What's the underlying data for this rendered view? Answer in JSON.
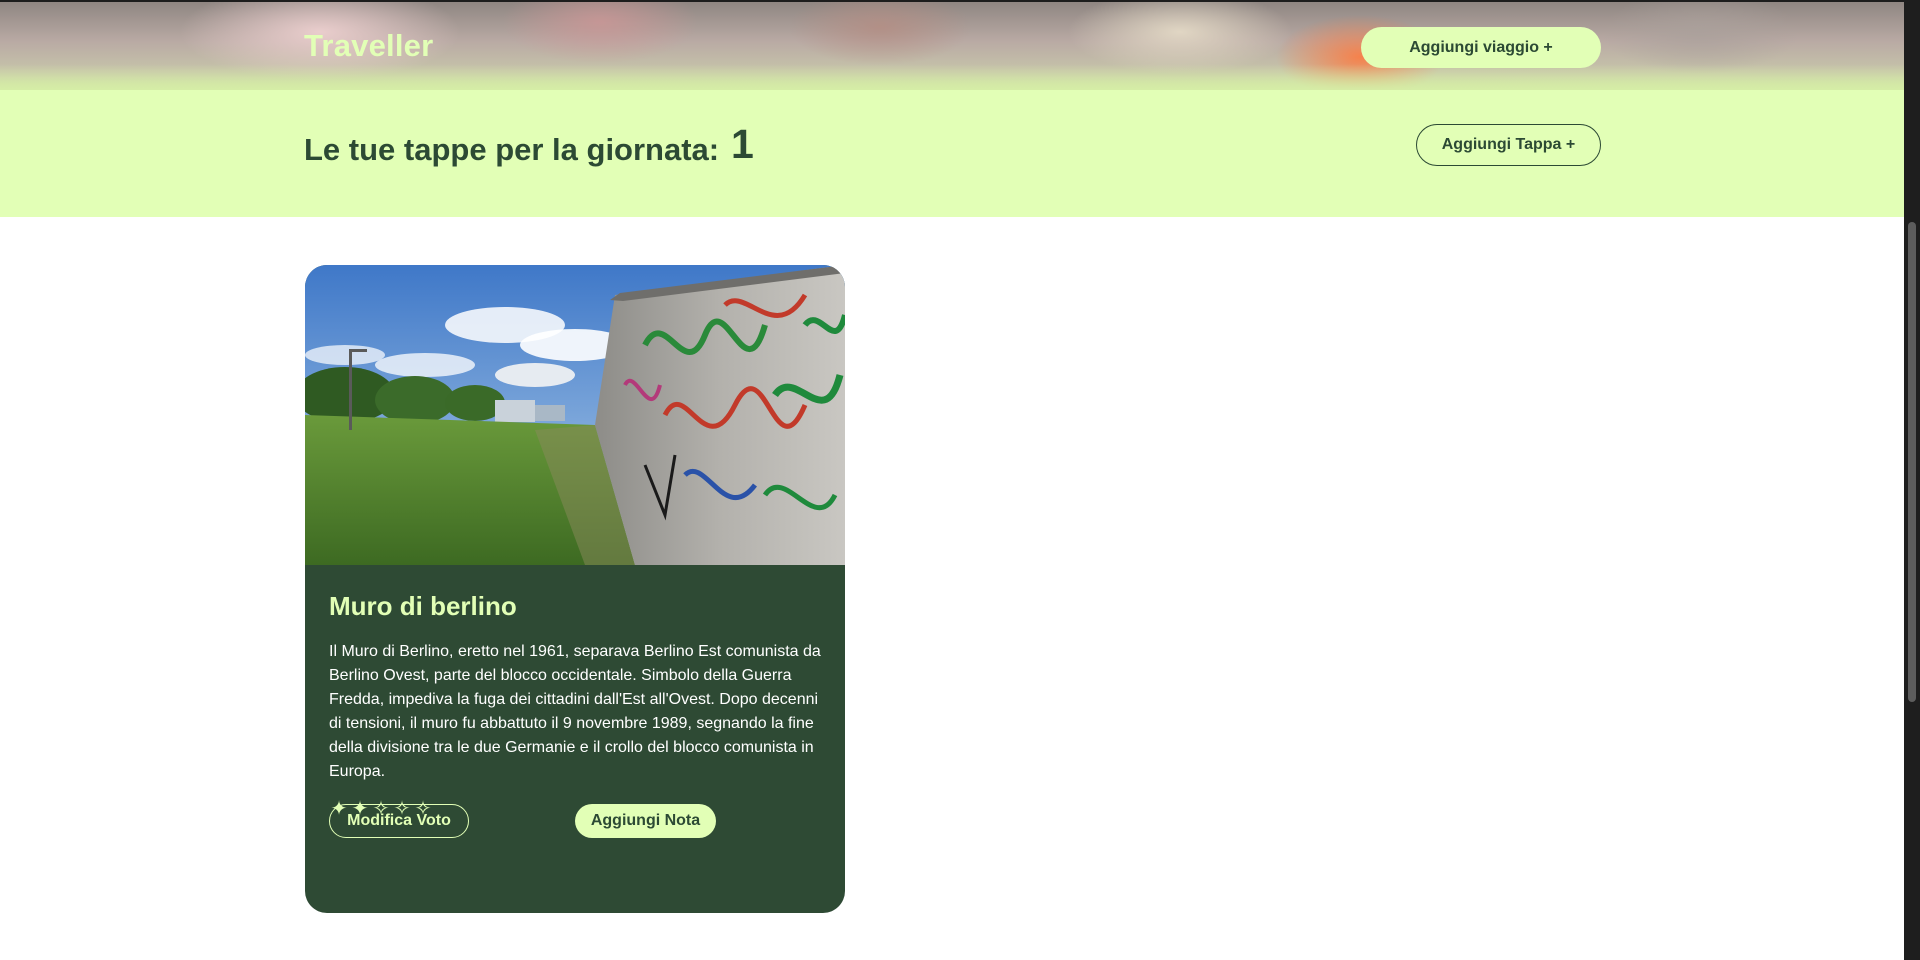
{
  "header": {
    "brand": "Traveller",
    "add_trip_label": "Aggiungi viaggio +"
  },
  "banner": {
    "title": "Le tue tappe per la giornata:",
    "count": "1",
    "add_stop_label": "Aggiungi Tappa +"
  },
  "card": {
    "image_icon": "berlin-wall-photo",
    "title": "Muro di berlino",
    "description": "Il Muro di Berlino, eretto nel 1961, separava Berlino Est comunista da Berlino Ovest, parte del blocco occidentale. Simbolo della Guerra Fredda, impediva la fuga dei cittadini dall'Est all'Ovest. Dopo decenni di tensioni, il muro fu abbattuto il 9 novembre 1989, segnando la fine della divisione tra le due Germanie e il crollo del blocco comunista in Europa.",
    "rating": {
      "value": 2,
      "max": 5,
      "filled_glyph": "✦",
      "empty_glyph": "✧"
    },
    "edit_vote_label": "Modifica Voto",
    "add_note_label": "Aggiungi Nota"
  },
  "colors": {
    "accent_light": "#e2ffb6",
    "dark_green": "#2e4a34",
    "text_dark": "#2c4a34"
  }
}
